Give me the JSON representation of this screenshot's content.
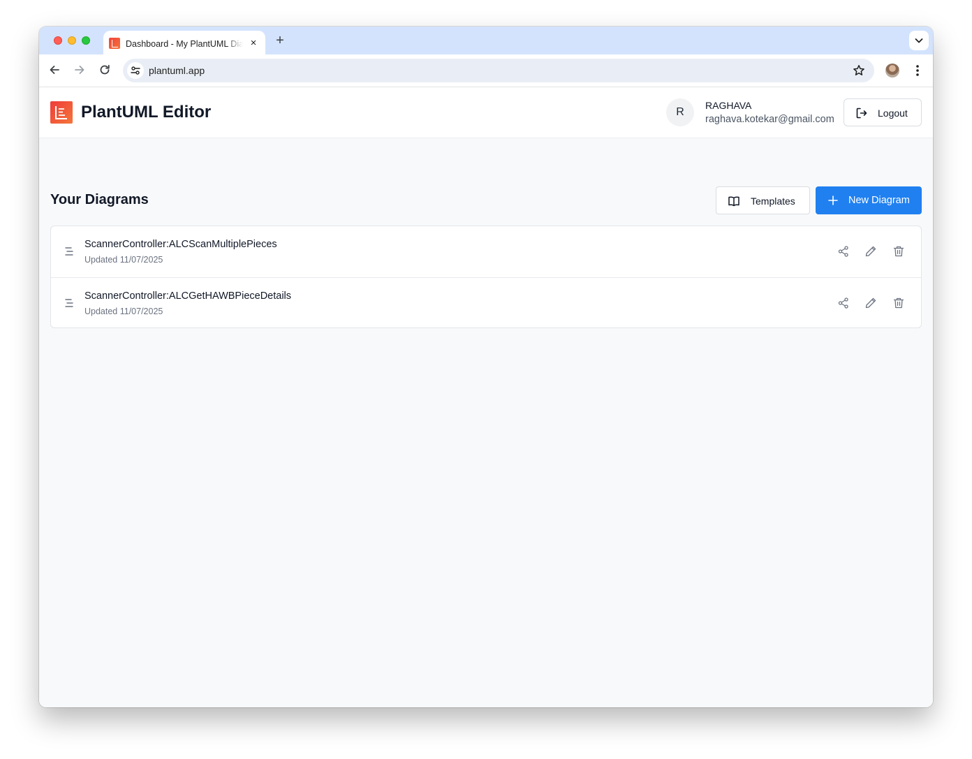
{
  "browser": {
    "tab_title": "Dashboard - My PlantUML Diagrams",
    "tab_close": "×",
    "new_tab": "+",
    "url": "plantuml.app"
  },
  "header": {
    "app_title": "PlantUML Editor",
    "user": {
      "initial": "R",
      "name": "RAGHAVA",
      "email": "raghava.kotekar@gmail.com"
    },
    "logout_label": "Logout"
  },
  "main": {
    "section_title": "Your Diagrams",
    "templates_label": "Templates",
    "new_diagram_label": "New Diagram",
    "diagrams": [
      {
        "title": "ScannerController:ALCScanMultiplePieces",
        "updated": "Updated 11/07/2025"
      },
      {
        "title": "ScannerController:ALCGetHAWBPieceDetails",
        "updated": "Updated 11/07/2025"
      }
    ]
  },
  "colors": {
    "accent": "#2080f0",
    "logo_gradient_start": "#ef3b3b",
    "logo_gradient_end": "#f4763a",
    "tabstrip": "#d3e3fd"
  },
  "icons": {
    "row_leading": "sequence-icon",
    "row_actions": [
      "share-icon",
      "edit-icon",
      "delete-icon"
    ]
  }
}
